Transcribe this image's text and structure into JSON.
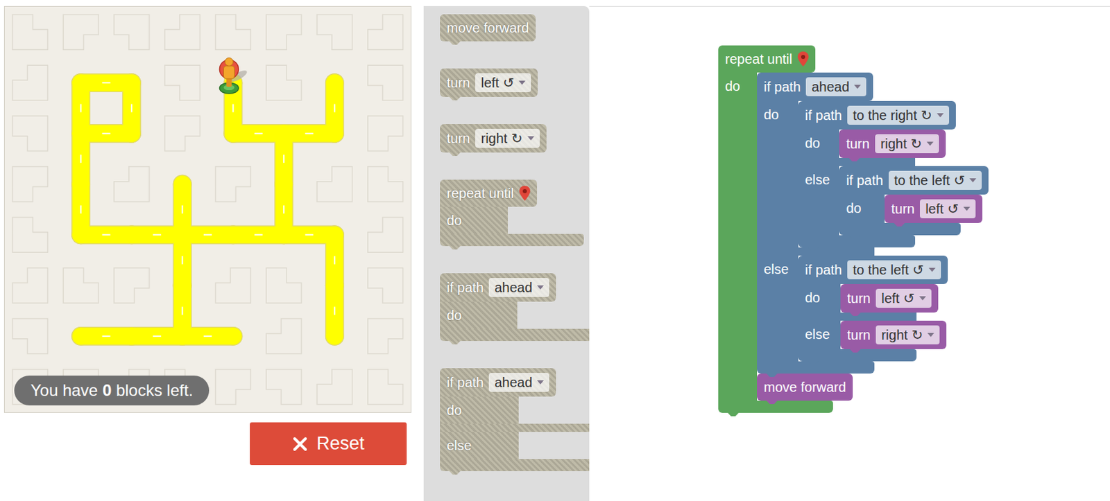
{
  "maze": {
    "grid": [
      "00000000",
      "01101010",
      "01101110",
      "01010100",
      "01111110",
      "00010010",
      "01111010",
      "00000000"
    ],
    "player": {
      "col": 4,
      "row": 1
    },
    "badge": {
      "prefix": "You have ",
      "count": "0",
      "suffix": " blocks left."
    }
  },
  "reset_button": {
    "label": "Reset"
  },
  "toolbox": [
    {
      "kind": "statement",
      "disabled": true,
      "fields": [
        {
          "kind": "label",
          "text": "move forward"
        }
      ]
    },
    {
      "kind": "statement",
      "disabled": true,
      "fields": [
        {
          "kind": "label",
          "text": "turn"
        },
        {
          "kind": "dropdown",
          "text": "left ↺"
        }
      ]
    },
    {
      "kind": "statement",
      "disabled": true,
      "fields": [
        {
          "kind": "label",
          "text": "turn"
        },
        {
          "kind": "dropdown",
          "text": "right ↻"
        }
      ]
    },
    {
      "kind": "c",
      "disabled": true,
      "fields": [
        {
          "kind": "label",
          "text": "repeat until"
        },
        {
          "kind": "marker"
        }
      ],
      "arms": [
        {
          "label": "do",
          "body": []
        }
      ]
    },
    {
      "kind": "c",
      "disabled": true,
      "fields": [
        {
          "kind": "label",
          "text": "if path"
        },
        {
          "kind": "dropdown",
          "text": "ahead"
        }
      ],
      "arms": [
        {
          "label": "do",
          "body": []
        }
      ]
    },
    {
      "kind": "c",
      "disabled": true,
      "fields": [
        {
          "kind": "label",
          "text": "if path"
        },
        {
          "kind": "dropdown",
          "text": "ahead"
        }
      ],
      "arms": [
        {
          "label": "do",
          "body": []
        },
        {
          "label": "else",
          "body": []
        }
      ]
    }
  ],
  "program": {
    "kind": "c",
    "color": "#5ba65b",
    "disabled": false,
    "fields": [
      {
        "kind": "label",
        "text": "repeat until"
      },
      {
        "kind": "marker"
      }
    ],
    "arms": [
      {
        "label": "do",
        "body": [
          {
            "kind": "c",
            "color": "#5b80a6",
            "disabled": false,
            "fields": [
              {
                "kind": "label",
                "text": "if path"
              },
              {
                "kind": "dropdown",
                "text": "ahead"
              }
            ],
            "arms": [
              {
                "label": "do",
                "body": [
                  {
                    "kind": "c",
                    "color": "#5b80a6",
                    "disabled": false,
                    "fields": [
                      {
                        "kind": "label",
                        "text": "if path"
                      },
                      {
                        "kind": "dropdown",
                        "text": "to the right ↻"
                      }
                    ],
                    "arms": [
                      {
                        "label": "do",
                        "body": [
                          {
                            "kind": "statement",
                            "color": "#995ba6",
                            "disabled": false,
                            "fields": [
                              {
                                "kind": "label",
                                "text": "turn"
                              },
                              {
                                "kind": "dropdown",
                                "text": "right ↻"
                              }
                            ]
                          }
                        ]
                      },
                      {
                        "label": "else",
                        "body": [
                          {
                            "kind": "c",
                            "color": "#5b80a6",
                            "disabled": false,
                            "fields": [
                              {
                                "kind": "label",
                                "text": "if path"
                              },
                              {
                                "kind": "dropdown",
                                "text": "to the left ↺"
                              }
                            ],
                            "arms": [
                              {
                                "label": "do",
                                "body": [
                                  {
                                    "kind": "statement",
                                    "color": "#995ba6",
                                    "disabled": false,
                                    "fields": [
                                      {
                                        "kind": "label",
                                        "text": "turn"
                                      },
                                      {
                                        "kind": "dropdown",
                                        "text": "left ↺"
                                      }
                                    ]
                                  }
                                ]
                              }
                            ]
                          }
                        ]
                      }
                    ]
                  }
                ]
              },
              {
                "label": "else",
                "body": [
                  {
                    "kind": "c",
                    "color": "#5b80a6",
                    "disabled": false,
                    "fields": [
                      {
                        "kind": "label",
                        "text": "if path"
                      },
                      {
                        "kind": "dropdown",
                        "text": "to the left ↺"
                      }
                    ],
                    "arms": [
                      {
                        "label": "do",
                        "body": [
                          {
                            "kind": "statement",
                            "color": "#995ba6",
                            "disabled": false,
                            "fields": [
                              {
                                "kind": "label",
                                "text": "turn"
                              },
                              {
                                "kind": "dropdown",
                                "text": "left ↺"
                              }
                            ]
                          }
                        ]
                      },
                      {
                        "label": "else",
                        "body": [
                          {
                            "kind": "statement",
                            "color": "#995ba6",
                            "disabled": false,
                            "fields": [
                              {
                                "kind": "label",
                                "text": "turn"
                              },
                              {
                                "kind": "dropdown",
                                "text": "right ↻"
                              }
                            ]
                          }
                        ]
                      }
                    ]
                  }
                ]
              }
            ]
          },
          {
            "kind": "statement",
            "color": "#995ba6",
            "disabled": false,
            "fields": [
              {
                "kind": "label",
                "text": "move forward"
              }
            ]
          }
        ]
      }
    ]
  }
}
